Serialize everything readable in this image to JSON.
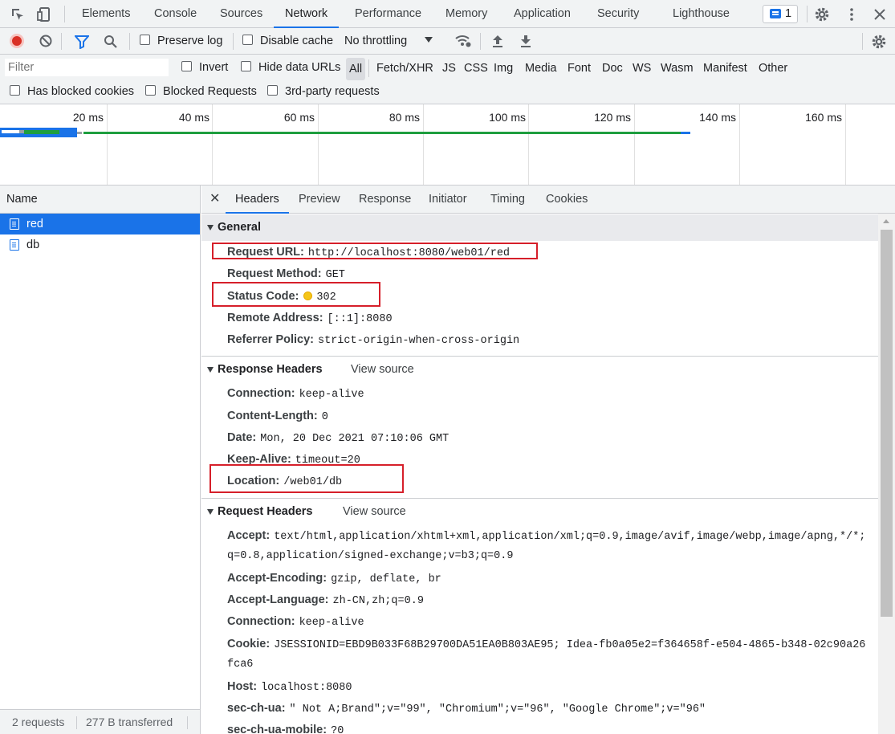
{
  "top_tabs": [
    "Elements",
    "Console",
    "Sources",
    "Network",
    "Performance",
    "Memory",
    "Application",
    "Security",
    "Lighthouse"
  ],
  "active_tab": "Network",
  "issues_count": "1",
  "toolbar": {
    "preserve_log": "Preserve log",
    "disable_cache": "Disable cache",
    "throttling": "No throttling"
  },
  "filter_bar": {
    "placeholder": "Filter",
    "invert": "Invert",
    "hide_data_urls": "Hide data URLs",
    "types": [
      "All",
      "Fetch/XHR",
      "JS",
      "CSS",
      "Img",
      "Media",
      "Font",
      "Doc",
      "WS",
      "Wasm",
      "Manifest",
      "Other"
    ],
    "has_blocked_cookies": "Has blocked cookies",
    "blocked_requests": "Blocked Requests",
    "third_party": "3rd-party requests"
  },
  "timeline": {
    "ticks": [
      "20 ms",
      "40 ms",
      "60 ms",
      "80 ms",
      "100 ms",
      "120 ms",
      "140 ms",
      "160 ms"
    ]
  },
  "request_list": {
    "header": "Name",
    "items": [
      "red",
      "db"
    ],
    "selected": "red",
    "status_requests": "2 requests",
    "status_transferred": "277 B transferred"
  },
  "details": {
    "tabs": [
      "Headers",
      "Preview",
      "Response",
      "Initiator",
      "Timing",
      "Cookies"
    ],
    "active": "Headers",
    "general": {
      "title": "General",
      "rows": [
        {
          "key": "Request URL:",
          "value": "http://localhost:8080/web01/red"
        },
        {
          "key": "Request Method:",
          "value": "GET"
        },
        {
          "key": "Status Code:",
          "value": "302"
        },
        {
          "key": "Remote Address:",
          "value": "[::1]:8080"
        },
        {
          "key": "Referrer Policy:",
          "value": "strict-origin-when-cross-origin"
        }
      ]
    },
    "response_headers": {
      "title": "Response Headers",
      "view_source": "View source",
      "rows": [
        {
          "key": "Connection:",
          "value": "keep-alive"
        },
        {
          "key": "Content-Length:",
          "value": "0"
        },
        {
          "key": "Date:",
          "value": "Mon, 20 Dec 2021 07:10:06 GMT"
        },
        {
          "key": "Keep-Alive:",
          "value": "timeout=20"
        },
        {
          "key": "Location:",
          "value": "/web01/db"
        }
      ]
    },
    "request_headers": {
      "title": "Request Headers",
      "view_source": "View source",
      "accept_key": "Accept:",
      "accept_value": "text/html,application/xhtml+xml,application/xml;q=0.9,image/avif,image/webp,image/apng,*/*;",
      "accept_value_cont": "q=0.8,application/signed-exchange;v=b3;q=0.9",
      "rows": [
        {
          "key": "Accept-Encoding:",
          "value": "gzip, deflate, br"
        },
        {
          "key": "Accept-Language:",
          "value": "zh-CN,zh;q=0.9"
        },
        {
          "key": "Connection:",
          "value": "keep-alive"
        }
      ],
      "cookie_key": "Cookie:",
      "cookie_value": "JSESSIONID=EBD9B033F68B29700DA51EA0B803AE95; Idea-fb0a05e2=f364658f-e504-4865-b348-02c90a26",
      "cookie_value_cont": "fca6",
      "rows2": [
        {
          "key": "Host:",
          "value": "localhost:8080"
        },
        {
          "key": "sec-ch-ua:",
          "value": "\" Not A;Brand\";v=\"99\", \"Chromium\";v=\"96\", \"Google Chrome\";v=\"96\""
        },
        {
          "key": "sec-ch-ua-mobile:",
          "value": "?0"
        }
      ]
    }
  }
}
